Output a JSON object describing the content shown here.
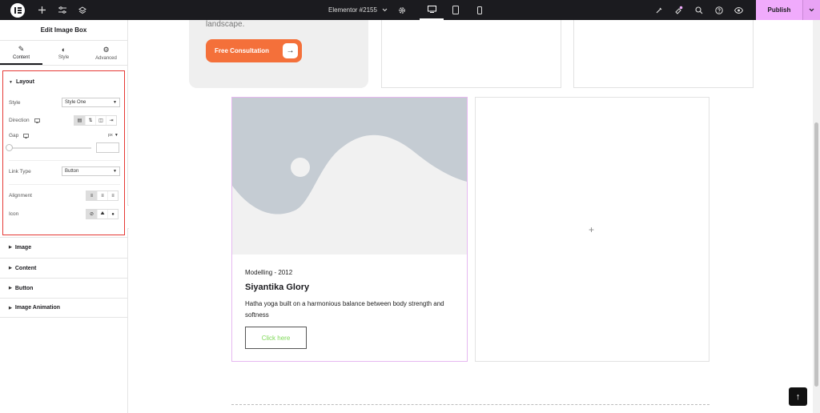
{
  "topbar": {
    "document_title": "Elementor #2155",
    "publish_label": "Publish"
  },
  "panel": {
    "title": "Edit Image Box",
    "tabs": [
      {
        "label": "Content",
        "icon": "pencil-icon"
      },
      {
        "label": "Style",
        "icon": "half-circle-icon"
      },
      {
        "label": "Advanced",
        "icon": "gear-icon"
      }
    ],
    "layout": {
      "heading": "Layout",
      "style_label": "Style",
      "style_value": "Style One",
      "direction_label": "Direction",
      "gap_label": "Gap",
      "gap_unit": "px",
      "link_type_label": "Link Type",
      "link_type_value": "Button",
      "alignment_label": "Alignment",
      "icon_label": "Icon"
    },
    "sections": [
      "Image",
      "Content",
      "Button",
      "Image Animation"
    ]
  },
  "canvas": {
    "top_card": {
      "text": "landscape.",
      "cta_label": "Free Consultation"
    },
    "image_box": {
      "subtitle": "Modelling - 2012",
      "title": "Siyantika Glory",
      "description": "Hatha yoga built on a harmonious balance between body strength and softness",
      "button_label": "Click here"
    }
  },
  "colors": {
    "accent_publish": "#f0abfc",
    "cta_orange": "#f4703a",
    "selection_outline": "#e53935",
    "button_text_green": "#7ed957"
  }
}
